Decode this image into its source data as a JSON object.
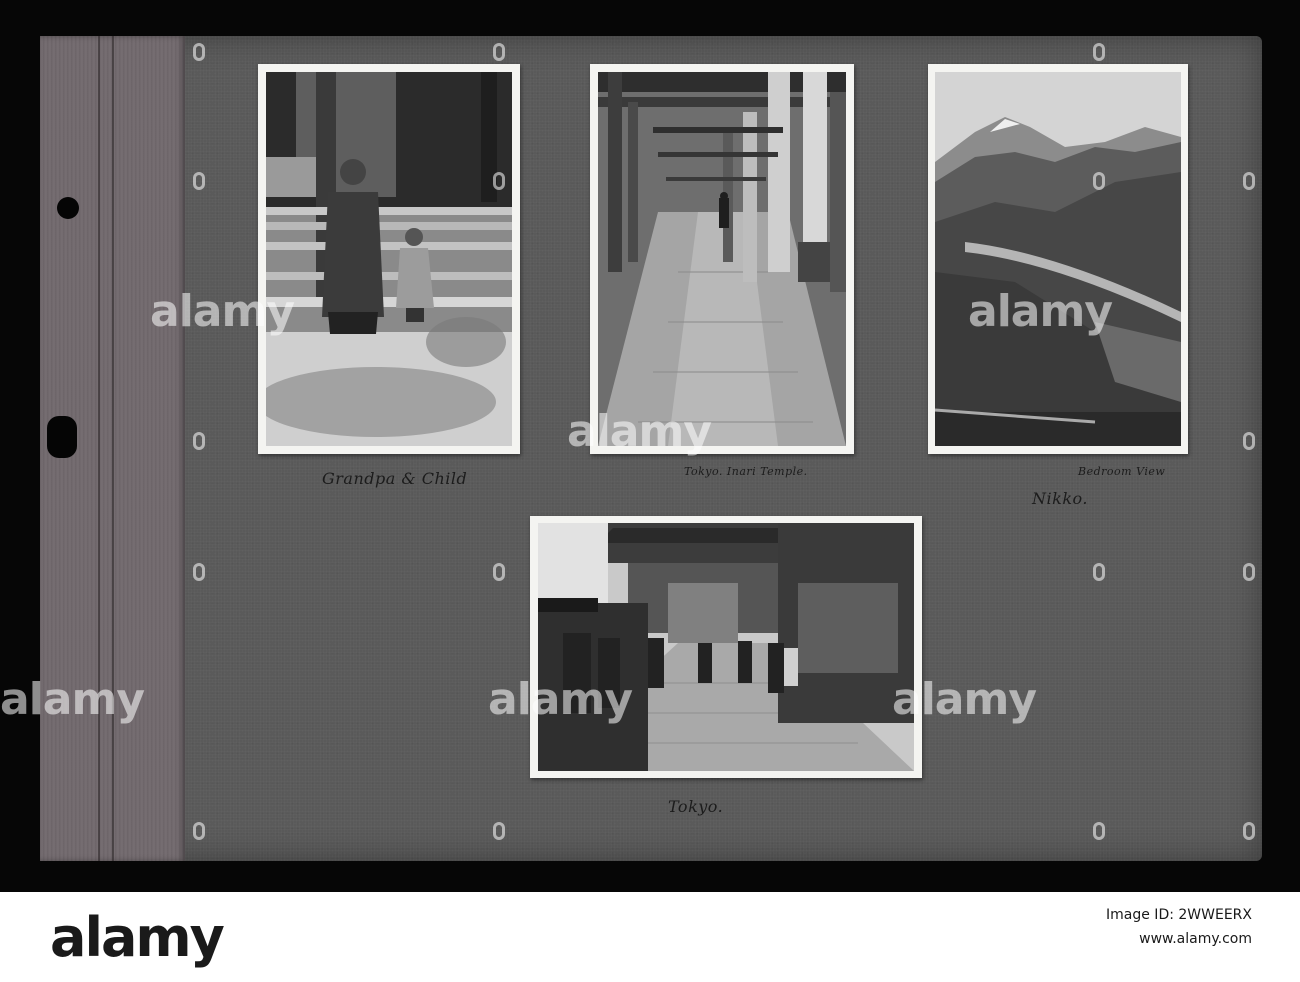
{
  "album": {
    "photos": [
      {
        "id": "grandpa",
        "caption": "Grandpa & Child"
      },
      {
        "id": "inari",
        "caption": "Tokyo. Inari Temple."
      },
      {
        "id": "nikko",
        "caption": "Bedroom View",
        "caption2": "Nikko."
      },
      {
        "id": "tokyo",
        "caption": "Tokyo."
      }
    ]
  },
  "watermark": {
    "text": "alamy"
  },
  "footer": {
    "brand": "alamy",
    "image_id_label": "Image ID: 2WWEERX",
    "site": "www.alamy.com"
  }
}
